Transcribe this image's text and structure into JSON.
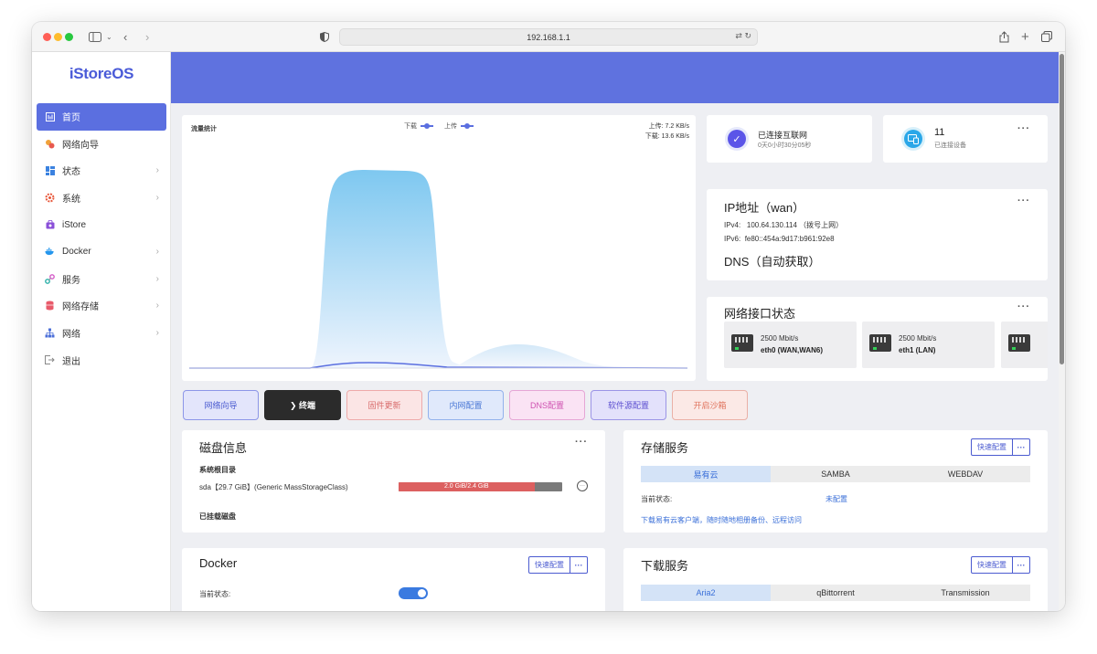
{
  "browser": {
    "url": "192.168.1.1"
  },
  "sidebar": {
    "logo": "iStoreOS",
    "items": [
      {
        "label": "首页",
        "icon": "home-icon",
        "active": true,
        "has_arrow": false
      },
      {
        "label": "网络向导",
        "icon": "wizard-icon",
        "has_arrow": false
      },
      {
        "label": "状态",
        "icon": "status-icon",
        "has_arrow": true
      },
      {
        "label": "系统",
        "icon": "system-gear-icon",
        "has_arrow": true
      },
      {
        "label": "iStore",
        "icon": "store-icon",
        "has_arrow": false
      },
      {
        "label": "Docker",
        "icon": "docker-icon",
        "has_arrow": true
      },
      {
        "label": "服务",
        "icon": "services-icon",
        "has_arrow": true
      },
      {
        "label": "网络存储",
        "icon": "storage-icon",
        "has_arrow": true
      },
      {
        "label": "网络",
        "icon": "network-icon",
        "has_arrow": true
      },
      {
        "label": "退出",
        "icon": "logout-icon",
        "has_arrow": false
      }
    ]
  },
  "traffic": {
    "title": "流量统计",
    "legend_download": "下载",
    "legend_upload": "上传",
    "upload_rate": "上传: 7.2 KB/s",
    "download_rate": "下载: 13.6 KB/s",
    "colors": {
      "download": "#7ec8f0",
      "upload": "#5b6fe0"
    }
  },
  "network_status": {
    "title": "已连接互联网",
    "uptime": "0天0小时30分05秒"
  },
  "devices": {
    "count": "11",
    "label": "已连接设备"
  },
  "ip_info": {
    "title": "IP地址（wan）",
    "ipv4_label": "IPv4:",
    "ipv4": "100.64.130.114 （拨号上网）",
    "ipv6_label": "IPv6:",
    "ipv6": "fe80::454a:9d17:b961:92e8",
    "dns_title": "DNS（自动获取）"
  },
  "interfaces": {
    "title": "网络接口状态",
    "items": [
      {
        "speed": "2500 Mbit/s",
        "name": "eth0 (WAN,WAN6)"
      },
      {
        "speed": "2500 Mbit/s",
        "name": "eth1 (LAN)"
      }
    ]
  },
  "quick_buttons": [
    {
      "label": "网络向导",
      "bg": "#e3e5fb",
      "border": "#8c96e8",
      "color": "#4b5bd0"
    },
    {
      "label": "❯ 终端",
      "bg": "#2b2b2b",
      "border": "#2b2b2b",
      "color": "#ffffff"
    },
    {
      "label": "固件更新",
      "bg": "#fbe5e5",
      "border": "#eeaaaa",
      "color": "#d86b6b"
    },
    {
      "label": "内网配置",
      "bg": "#e0e9fb",
      "border": "#92b2ec",
      "color": "#4a78d6"
    },
    {
      "label": "DNS配置",
      "bg": "#fae3f4",
      "border": "#e6a6d6",
      "color": "#cf52b1"
    },
    {
      "label": "软件源配置",
      "bg": "#e3e1fb",
      "border": "#9b94e6",
      "color": "#5c4fd0"
    },
    {
      "label": "开启沙箱",
      "bg": "#fbe9e6",
      "border": "#eab0a6",
      "color": "#e0755f"
    }
  ],
  "disk": {
    "title": "磁盘信息",
    "root_label": "系统根目录",
    "disk_name": "sda【29.7 GiB】(Generic MassStorageClass)",
    "usage_text": "2.0 GiB/2.4 GiB",
    "usage_fraction": 0.83,
    "mounted_label": "已挂载磁盘"
  },
  "storage": {
    "title": "存储服务",
    "quick_config": "快速配置",
    "tabs": [
      "易有云",
      "SAMBA",
      "WEBDAV"
    ],
    "active_tab": 0,
    "status_label": "当前状态:",
    "status_value": "未配置",
    "download_link": "下载易有云客户端，随时随地相册备份、远程访问"
  },
  "docker": {
    "title": "Docker",
    "quick_config": "快速配置",
    "status_label": "当前状态:",
    "enabled": true
  },
  "download_service": {
    "title": "下载服务",
    "quick_config": "快速配置",
    "tabs": [
      "Aria2",
      "qBittorrent",
      "Transmission"
    ],
    "active_tab": 0
  }
}
